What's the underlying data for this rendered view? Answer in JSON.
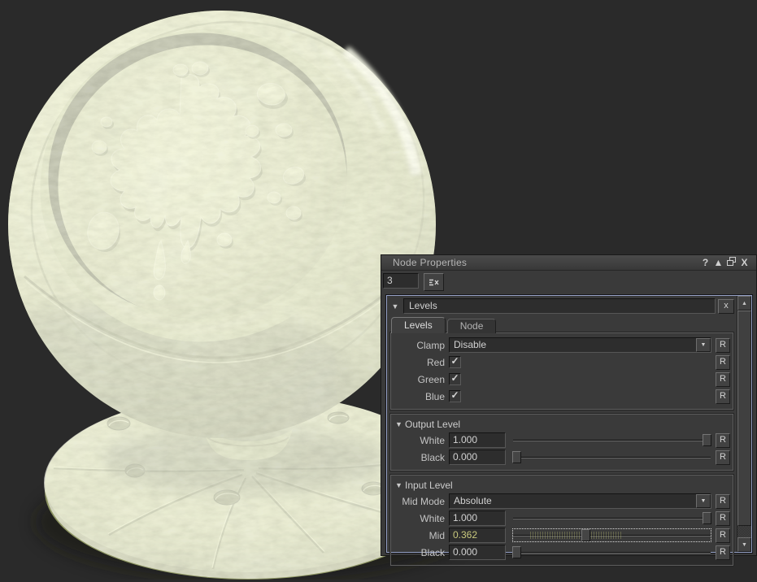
{
  "window": {
    "title": "Node Properties",
    "help": "?",
    "dock": "▲",
    "close": "X"
  },
  "node_selector": {
    "value": "3"
  },
  "panel": {
    "collapse": "▼",
    "title": "Levels",
    "close": "x",
    "tabs": {
      "levels": "Levels",
      "node": "Node"
    },
    "reset": "R",
    "check": "✓",
    "dropdown_arrow": "▼",
    "clamp": {
      "label": "Clamp",
      "value": "Disable"
    },
    "red": {
      "label": "Red",
      "checked": true
    },
    "green": {
      "label": "Green",
      "checked": true
    },
    "blue": {
      "label": "Blue",
      "checked": true
    },
    "output_level": {
      "title": "Output Level",
      "white": {
        "label": "White",
        "value": "1.000",
        "fraction": 1
      },
      "black": {
        "label": "Black",
        "value": "0.000",
        "fraction": 0
      }
    },
    "input_level": {
      "title": "Input Level",
      "mid_mode": {
        "label": "Mid Mode",
        "value": "Absolute"
      },
      "white": {
        "label": "White",
        "value": "1.000",
        "fraction": 1
      },
      "mid": {
        "label": "Mid",
        "value": "0.362",
        "fraction": 0.362,
        "focused": true
      },
      "black": {
        "label": "Black",
        "value": "0.000",
        "fraction": 0
      }
    }
  },
  "scrollbar": {
    "up": "▲",
    "down": "▼"
  },
  "preview": {
    "colors": {
      "material_base": "#c3cb92",
      "material_light": "#eef2cf",
      "material_shadow": "#7c8454",
      "background": "#2a2a2a",
      "mid_value_text": "#c9c97d",
      "focus_border": "#96a2c6"
    }
  }
}
